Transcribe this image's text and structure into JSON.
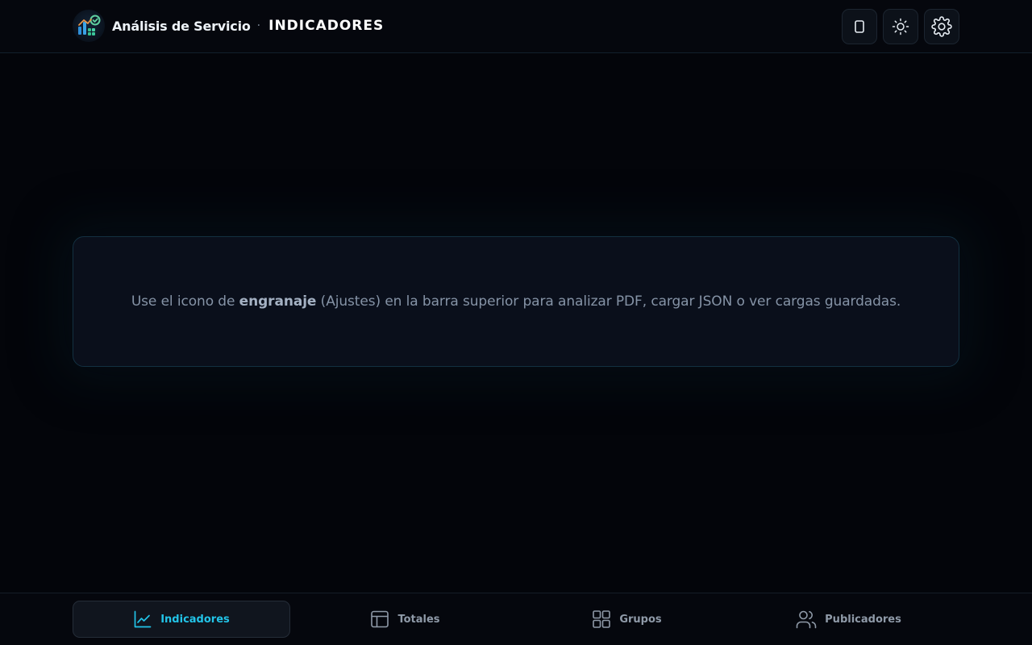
{
  "header": {
    "app_title": "Análisis de Servicio",
    "separator": "·",
    "section_title": "INDICADORES",
    "actions": [
      {
        "icon": "square-icon"
      },
      {
        "icon": "sun-icon"
      },
      {
        "icon": "gear-icon"
      }
    ]
  },
  "main": {
    "message_before": "Use el icono de ",
    "message_emphasis": "engranaje",
    "message_after": " (Ajustes) en la barra superior para analizar PDF, cargar JSON o ver cargas guardadas."
  },
  "bottom_nav": {
    "items": [
      {
        "label": "Indicadores",
        "icon": "line-chart-icon",
        "active": true
      },
      {
        "label": "Totales",
        "icon": "table-icon",
        "active": false
      },
      {
        "label": "Grupos",
        "icon": "grid-icon",
        "active": false
      },
      {
        "label": "Publicadores",
        "icon": "users-icon",
        "active": false
      }
    ]
  },
  "colors": {
    "background": "#03050a",
    "accent": "#22c4e8",
    "card_border": "#133041",
    "muted_text": "#8593a6"
  }
}
